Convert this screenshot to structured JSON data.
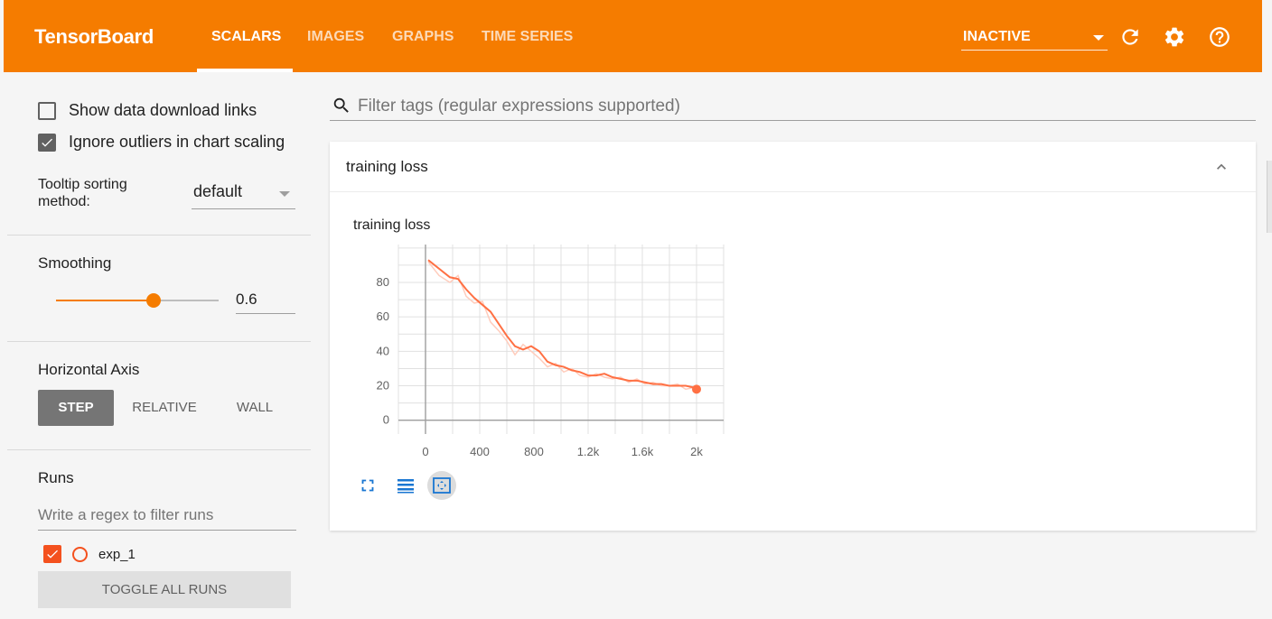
{
  "app": {
    "title": "TensorBoard",
    "accent": "#f57c00"
  },
  "nav": {
    "tabs": [
      {
        "label": "SCALARS",
        "active": true
      },
      {
        "label": "IMAGES",
        "active": false
      },
      {
        "label": "GRAPHS",
        "active": false
      },
      {
        "label": "TIME SERIES",
        "active": false
      }
    ],
    "run_status": "INACTIVE",
    "icons": [
      "refresh-icon",
      "settings-icon",
      "help-icon"
    ]
  },
  "sidebar": {
    "show_download_links": {
      "label": "Show data download links",
      "checked": false
    },
    "ignore_outliers": {
      "label": "Ignore outliers in chart scaling",
      "checked": true
    },
    "tooltip_sorting": {
      "label": "Tooltip sorting method:",
      "value": "default"
    },
    "smoothing": {
      "label": "Smoothing",
      "value": "0.6",
      "level": 0.6
    },
    "horizontal_axis": {
      "label": "Horizontal Axis",
      "options": [
        "STEP",
        "RELATIVE",
        "WALL"
      ],
      "selected": "STEP"
    },
    "runs": {
      "label": "Runs",
      "filter_placeholder": "Write a regex to filter runs",
      "items": [
        {
          "name": "exp_1",
          "checked": true,
          "color": "#f4511e"
        }
      ],
      "toggle_label": "TOGGLE ALL RUNS"
    }
  },
  "main": {
    "filter_placeholder": "Filter tags (regular expressions supported)",
    "card": {
      "title": "training loss",
      "chart_title": "training loss"
    }
  },
  "chart_data": {
    "type": "line",
    "title": "training loss",
    "xlabel": "",
    "ylabel": "",
    "xlim": [
      -200,
      2200
    ],
    "ylim": [
      -8,
      102
    ],
    "x_ticks": [
      "0",
      "400",
      "800",
      "1.2k",
      "1.6k",
      "2k"
    ],
    "x_tick_values": [
      0,
      400,
      800,
      1200,
      1600,
      2000
    ],
    "y_ticks": [
      "0",
      "20",
      "40",
      "60",
      "80"
    ],
    "y_tick_values": [
      0,
      20,
      40,
      60,
      80
    ],
    "grid": true,
    "series": [
      {
        "color": "#ff7043",
        "raw_color": "#ffccbc",
        "x": [
          20,
          100,
          180,
          240,
          300,
          360,
          420,
          480,
          540,
          600,
          660,
          720,
          780,
          840,
          900,
          960,
          1020,
          1080,
          1140,
          1200,
          1260,
          1320,
          1380,
          1440,
          1500,
          1560,
          1620,
          1680,
          1740,
          1800,
          1860,
          1920,
          1980,
          2000
        ],
        "y": [
          93,
          88,
          83,
          82,
          76,
          71,
          67,
          63,
          56,
          49,
          43,
          41,
          43,
          40,
          34,
          32,
          31,
          29,
          28,
          26,
          26,
          27,
          25,
          24,
          23,
          23,
          22,
          21,
          21,
          20,
          20,
          20,
          19,
          18
        ],
        "raw_y": [
          92,
          84,
          80,
          84,
          72,
          68,
          69,
          57,
          52,
          46,
          38,
          44,
          40,
          36,
          31,
          33,
          28,
          30,
          26,
          25,
          27,
          25,
          24,
          25,
          22,
          24,
          21,
          22,
          20,
          20,
          21,
          18,
          19,
          18
        ]
      }
    ]
  }
}
